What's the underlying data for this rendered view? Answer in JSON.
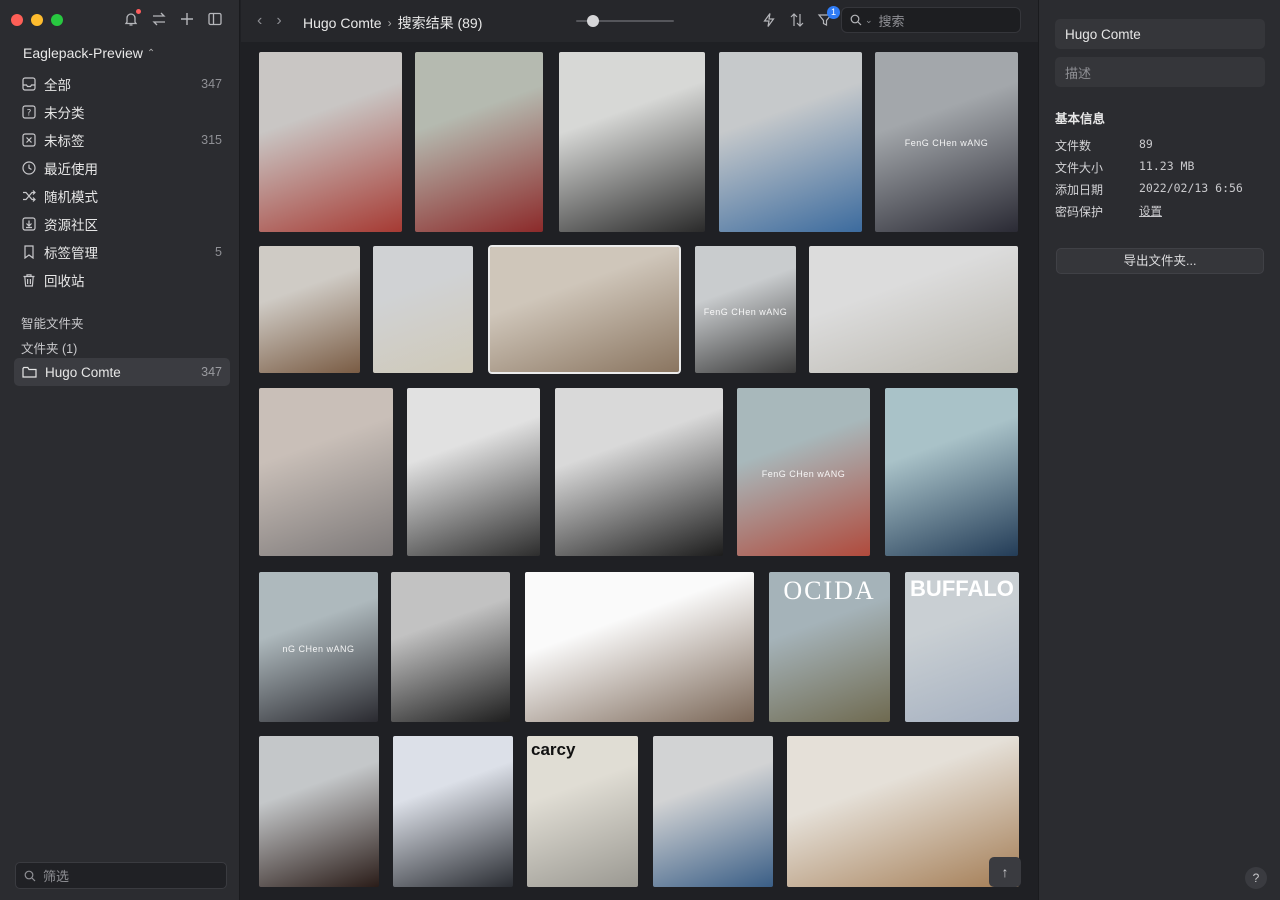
{
  "sidebar": {
    "library_name": "Eaglepack-Preview",
    "nav": [
      {
        "label": "全部",
        "count": "347",
        "icon": "all-items-icon"
      },
      {
        "label": "未分类",
        "count": "",
        "icon": "uncategorized-icon"
      },
      {
        "label": "未标签",
        "count": "315",
        "icon": "untagged-icon"
      },
      {
        "label": "最近使用",
        "count": "",
        "icon": "recent-icon"
      },
      {
        "label": "随机模式",
        "count": "",
        "icon": "shuffle-icon"
      },
      {
        "label": "资源社区",
        "count": "",
        "icon": "community-icon"
      },
      {
        "label": "标签管理",
        "count": "5",
        "icon": "tag-icon"
      },
      {
        "label": "回收站",
        "count": "",
        "icon": "trash-icon"
      }
    ],
    "smart_folders_label": "智能文件夹",
    "folders_label": "文件夹 (1)",
    "folder": {
      "label": "Hugo Comte",
      "count": "347"
    },
    "filter_placeholder": "筛选"
  },
  "topbar": {
    "folder": "Hugo Comte",
    "results": "搜索结果 (89)",
    "filter_badge": "1",
    "search_placeholder": "搜索"
  },
  "grid": {
    "images": [
      {
        "caption": "",
        "colors": [
          "#c9c6c4",
          "#a63a33"
        ]
      },
      {
        "caption": "",
        "colors": [
          "#b5bab0",
          "#8c2a2a"
        ]
      },
      {
        "caption": "",
        "colors": [
          "#d7d8d6",
          "#2a2a2a"
        ]
      },
      {
        "caption": "",
        "colors": [
          "#c6c9cb",
          "#3c6b9e"
        ]
      },
      {
        "caption": "FenG CHen wANG",
        "colors": [
          "#a3a7ab",
          "#2a2a34"
        ]
      },
      {
        "caption": "",
        "colors": [
          "#cfcbc5",
          "#7a5c44"
        ]
      },
      {
        "caption": "",
        "colors": [
          "#d0d2d4",
          "#cfc9b8"
        ]
      },
      {
        "caption": "",
        "colors": [
          "#cfc6ba",
          "#8a7560"
        ]
      },
      {
        "caption": "FenG CHen wANG",
        "colors": [
          "#c9ccce",
          "#3a3a3a"
        ]
      },
      {
        "caption": "",
        "colors": [
          "#dcdcdc",
          "#b9b6ad"
        ]
      },
      {
        "caption": "",
        "colors": [
          "#c9bfb8",
          "#7c7878"
        ]
      },
      {
        "caption": "",
        "colors": [
          "#e1e1e1",
          "#2d2d2d"
        ]
      },
      {
        "caption": "",
        "colors": [
          "#d9d9d9",
          "#1c1c1c"
        ]
      },
      {
        "caption": "FenG CHen wANG",
        "colors": [
          "#a8b8bb",
          "#b04a3c"
        ]
      },
      {
        "caption": "",
        "colors": [
          "#a9c2c8",
          "#233c57"
        ]
      },
      {
        "caption": "nG CHen wANG",
        "colors": [
          "#aeb9bd",
          "#2a2a30"
        ]
      },
      {
        "caption": "",
        "colors": [
          "#c2c2c2",
          "#1e1e1e"
        ]
      },
      {
        "caption": "",
        "colors": [
          "#fafafa",
          "#7a6656"
        ]
      },
      {
        "caption": "OCIDA",
        "colors": [
          "#a5b3b9",
          "#6f6a50"
        ]
      },
      {
        "caption": "BUFFALO",
        "colors": [
          "#c9cfd3",
          "#a5b0c0"
        ]
      },
      {
        "caption": "",
        "colors": [
          "#c4c7c9",
          "#2a1c18"
        ]
      },
      {
        "caption": "",
        "colors": [
          "#dce0e8",
          "#2a2d33"
        ]
      },
      {
        "caption": "carcy",
        "colors": [
          "#e0ddd4",
          "#9a9891"
        ]
      },
      {
        "caption": "",
        "colors": [
          "#d2d3d4",
          "#3a5e86"
        ]
      },
      {
        "caption": "",
        "colors": [
          "#e5e0d8",
          "#a47d55"
        ]
      }
    ]
  },
  "inspector": {
    "name": "Hugo Comte",
    "description_placeholder": "描述",
    "section_title": "基本信息",
    "rows": [
      {
        "key": "文件数",
        "value": "89"
      },
      {
        "key": "文件大小",
        "value": "11.23 MB"
      },
      {
        "key": "添加日期",
        "value": "2022/02/13 6:56"
      },
      {
        "key": "密码保护",
        "value": "设置"
      }
    ],
    "export_label": "导出文件夹...",
    "help": "?"
  }
}
